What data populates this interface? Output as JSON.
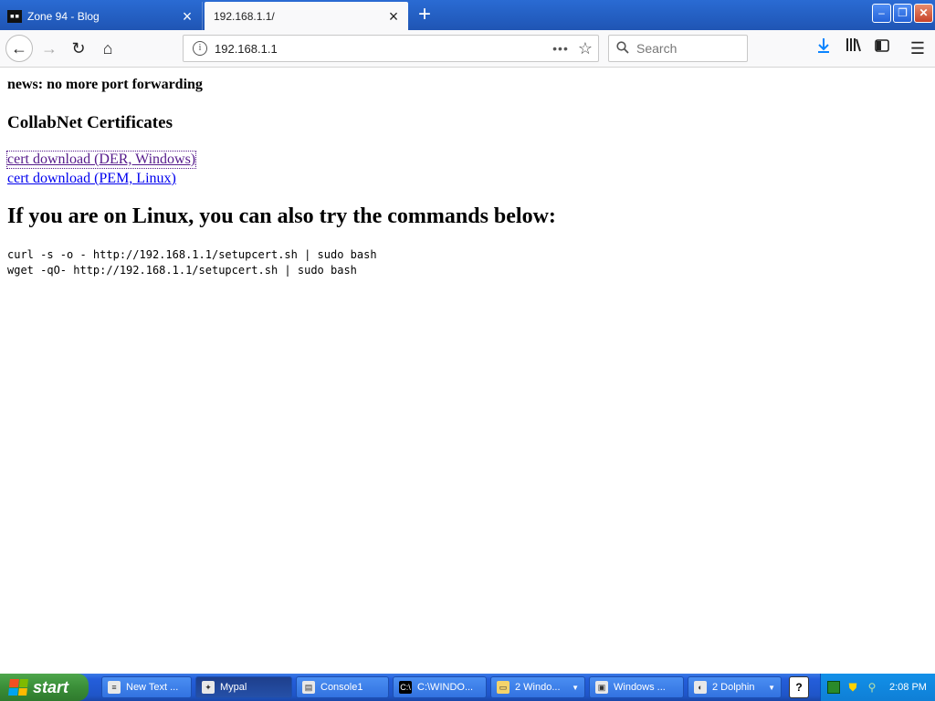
{
  "browser": {
    "tabs": [
      {
        "title": "Zone 94 - Blog",
        "favicon": "terminal-favicon",
        "active": false
      },
      {
        "title": "192.168.1.1/",
        "active": true
      }
    ],
    "url": "192.168.1.1",
    "search_placeholder": "Search",
    "more_label": "•••"
  },
  "page": {
    "news": "news: no more port forwarding",
    "section_title": "CollabNet Certificates",
    "links": [
      {
        "label": "cert download (DER, Windows)",
        "visited": true
      },
      {
        "label": "cert download (PEM, Linux)",
        "visited": false
      }
    ],
    "linux_heading": "If you are on Linux, you can also try the commands below:",
    "commands": [
      "curl -s -o - http://192.168.1.1/setupcert.sh | sudo bash",
      "wget -qO- http://192.168.1.1/setupcert.sh | sudo bash"
    ]
  },
  "taskbar": {
    "start_label": "start",
    "tasks": [
      {
        "label": "New Text ...",
        "icon": "notepad-icon"
      },
      {
        "label": "Mypal",
        "icon": "mypal-icon",
        "active": true
      },
      {
        "label": "Console1",
        "icon": "console-icon"
      },
      {
        "label": "C:\\WINDO...",
        "icon": "cmd-icon"
      },
      {
        "label": "2 Windo...",
        "icon": "folder-icon",
        "grouped": true
      },
      {
        "label": "Windows ...",
        "icon": "monitor-icon"
      },
      {
        "label": "2 Dolphin",
        "icon": "dolphin-icon",
        "grouped": true
      }
    ],
    "help_label": "?",
    "clock": "2:08 PM"
  },
  "colors": {
    "titlebar": "#1f55b4",
    "visited_link": "#551a8b",
    "link": "#0000ee",
    "taskbar": "#245edb",
    "start_button": "#3a8e38"
  }
}
